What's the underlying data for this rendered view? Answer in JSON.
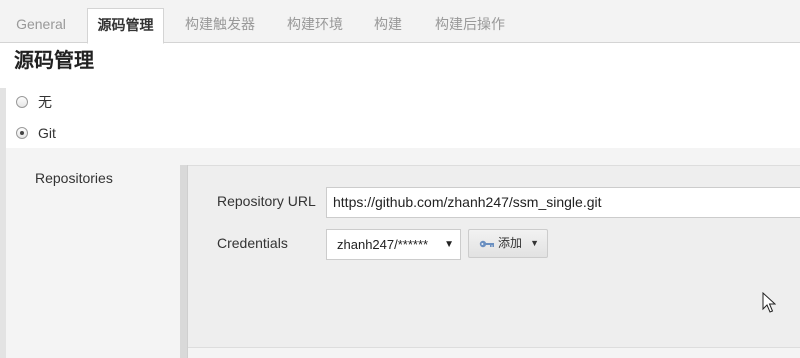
{
  "tabs": [
    {
      "label": "General",
      "active": false
    },
    {
      "label": "源码管理",
      "active": true
    },
    {
      "label": "构建触发器",
      "active": false
    },
    {
      "label": "构建环境",
      "active": false
    },
    {
      "label": "构建",
      "active": false
    },
    {
      "label": "构建后操作",
      "active": false
    }
  ],
  "section": {
    "title": "源码管理"
  },
  "scm_options": [
    {
      "label": "无",
      "checked": false
    },
    {
      "label": "Git",
      "checked": true
    }
  ],
  "repositories": {
    "label": "Repositories",
    "url_label": "Repository URL",
    "url_value": "https://github.com/zhanh247/ssm_single.git",
    "credentials_label": "Credentials",
    "credentials_value": "zhanh247/******",
    "add_button_label": "添加",
    "add_button_icon": "key-icon",
    "dropdown_icon": "caret-down-icon"
  },
  "colors": {
    "tabbar_bg": "#f3f3f3",
    "panel_bg": "#eeeeee",
    "key_icon": "#6a8fc0"
  }
}
